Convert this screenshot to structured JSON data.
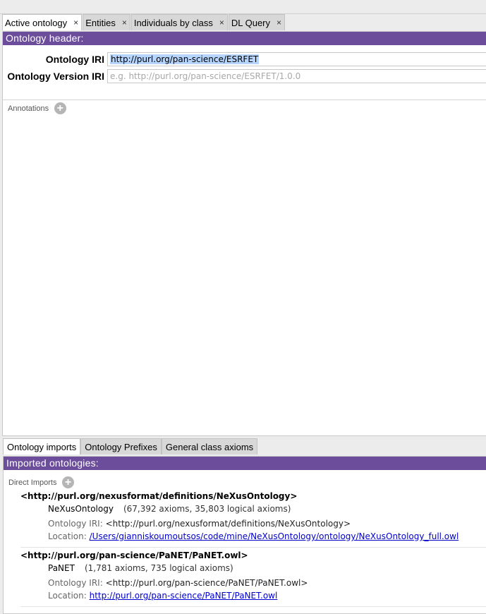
{
  "tabs": [
    {
      "label": "Active ontology",
      "close": "×"
    },
    {
      "label": "Entities",
      "close": "×"
    },
    {
      "label": "Individuals by class",
      "close": "×"
    },
    {
      "label": "DL Query",
      "close": "×"
    }
  ],
  "header": {
    "title": "Ontology header:",
    "iri_label": "Ontology IRI",
    "iri_value": "http://purl.org/pan-science/ESRFET",
    "version_label": "Ontology Version IRI",
    "version_placeholder": "e.g. http://purl.org/pan-science/ESRFET/1.0.0"
  },
  "annotations": {
    "label": "Annotations",
    "add": "+"
  },
  "bottom_tabs": [
    {
      "label": "Ontology imports"
    },
    {
      "label": "Ontology Prefixes"
    },
    {
      "label": "General class axioms"
    }
  ],
  "imports": {
    "title": "Imported ontologies:",
    "direct_label": "Direct Imports",
    "add": "+",
    "iri_key": "Ontology IRI:",
    "location_key": "Location:",
    "entries": [
      {
        "iri": "<http://purl.org/nexusformat/definitions/NeXusOntology>",
        "name": "NeXusOntology",
        "counts": "(67,392 axioms, 35,803 logical axioms)",
        "ontology_iri": "<http://purl.org/nexusformat/definitions/NeXusOntology>",
        "location": "/Users/gianniskoumoutsos/code/mine/NeXusOntology/ontology/NeXusOntology_full.owl"
      },
      {
        "iri": "<http://purl.org/pan-science/PaNET/PaNET.owl>",
        "name": "PaNET",
        "counts": "(1,781 axioms, 735 logical axioms)",
        "ontology_iri": "<http://purl.org/pan-science/PaNET/PaNET.owl>",
        "location": "http://purl.org/pan-science/PaNET/PaNET.owl"
      }
    ]
  }
}
